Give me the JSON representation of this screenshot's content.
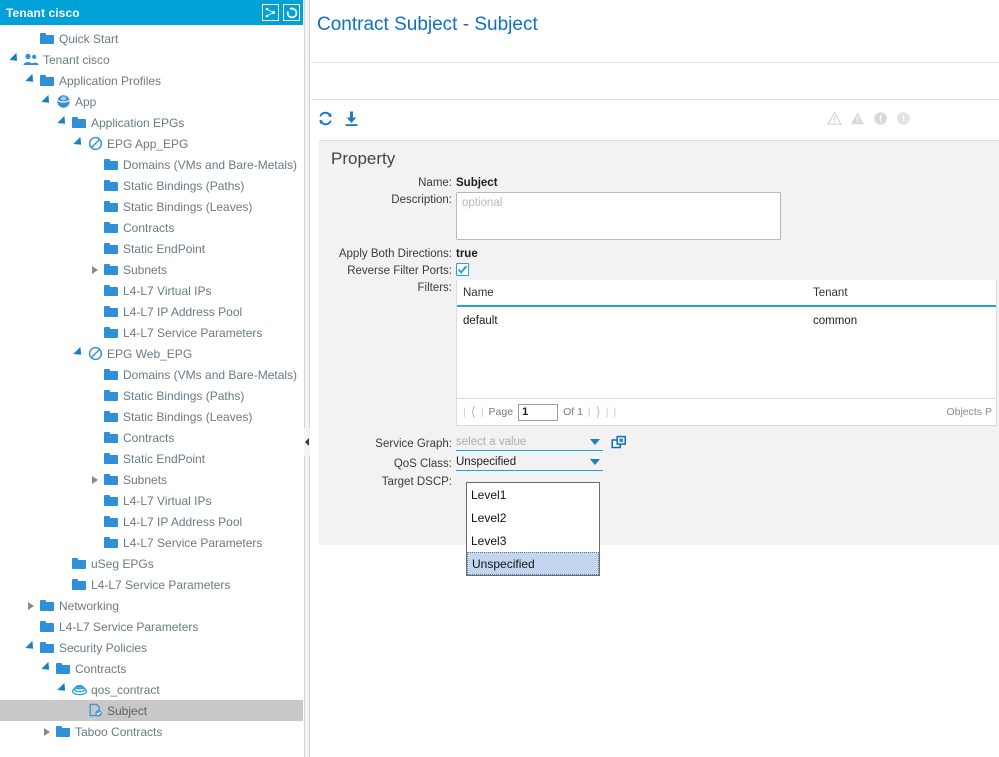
{
  "sidebar": {
    "title": "Tenant cisco",
    "title_icons": [
      {
        "name": "topology-icon"
      },
      {
        "name": "refresh-icon"
      }
    ],
    "tree": [
      {
        "label": "Quick Start",
        "indent": 1,
        "twisty": "none",
        "icon": "folder-icon"
      },
      {
        "label": "Tenant cisco",
        "indent": 0,
        "twisty": "open",
        "icon": "tenant-users-icon"
      },
      {
        "label": "Application Profiles",
        "indent": 1,
        "twisty": "open",
        "icon": "folder-icon"
      },
      {
        "label": "App",
        "indent": 2,
        "twisty": "open",
        "icon": "app-sphere-icon"
      },
      {
        "label": "Application EPGs",
        "indent": 3,
        "twisty": "open",
        "icon": "folder-icon"
      },
      {
        "label": "EPG App_EPG",
        "indent": 4,
        "twisty": "open",
        "icon": "epg-prohibit-icon"
      },
      {
        "label": "Domains (VMs and Bare-Metals)",
        "indent": 5,
        "twisty": "none",
        "icon": "folder-icon"
      },
      {
        "label": "Static Bindings (Paths)",
        "indent": 5,
        "twisty": "none",
        "icon": "folder-icon"
      },
      {
        "label": "Static Bindings (Leaves)",
        "indent": 5,
        "twisty": "none",
        "icon": "folder-icon"
      },
      {
        "label": "Contracts",
        "indent": 5,
        "twisty": "none",
        "icon": "folder-icon"
      },
      {
        "label": "Static EndPoint",
        "indent": 5,
        "twisty": "none",
        "icon": "folder-icon"
      },
      {
        "label": "Subnets",
        "indent": 5,
        "twisty": "closed",
        "icon": "folder-icon"
      },
      {
        "label": "L4-L7 Virtual IPs",
        "indent": 5,
        "twisty": "none",
        "icon": "folder-icon"
      },
      {
        "label": "L4-L7 IP Address Pool",
        "indent": 5,
        "twisty": "none",
        "icon": "folder-icon"
      },
      {
        "label": "L4-L7 Service Parameters",
        "indent": 5,
        "twisty": "none",
        "icon": "folder-icon"
      },
      {
        "label": "EPG Web_EPG",
        "indent": 4,
        "twisty": "open",
        "icon": "epg-prohibit-icon"
      },
      {
        "label": "Domains (VMs and Bare-Metals)",
        "indent": 5,
        "twisty": "none",
        "icon": "folder-icon"
      },
      {
        "label": "Static Bindings (Paths)",
        "indent": 5,
        "twisty": "none",
        "icon": "folder-icon"
      },
      {
        "label": "Static Bindings (Leaves)",
        "indent": 5,
        "twisty": "none",
        "icon": "folder-icon"
      },
      {
        "label": "Contracts",
        "indent": 5,
        "twisty": "none",
        "icon": "folder-icon"
      },
      {
        "label": "Static EndPoint",
        "indent": 5,
        "twisty": "none",
        "icon": "folder-icon"
      },
      {
        "label": "Subnets",
        "indent": 5,
        "twisty": "closed",
        "icon": "folder-icon"
      },
      {
        "label": "L4-L7 Virtual IPs",
        "indent": 5,
        "twisty": "none",
        "icon": "folder-icon"
      },
      {
        "label": "L4-L7 IP Address Pool",
        "indent": 5,
        "twisty": "none",
        "icon": "folder-icon"
      },
      {
        "label": "L4-L7 Service Parameters",
        "indent": 5,
        "twisty": "none",
        "icon": "folder-icon"
      },
      {
        "label": "uSeg EPGs",
        "indent": 3,
        "twisty": "none",
        "icon": "folder-icon"
      },
      {
        "label": "L4-L7 Service Parameters",
        "indent": 3,
        "twisty": "none",
        "icon": "folder-icon"
      },
      {
        "label": "Networking",
        "indent": 1,
        "twisty": "closed",
        "icon": "folder-icon"
      },
      {
        "label": "L4-L7 Service Parameters",
        "indent": 1,
        "twisty": "none",
        "icon": "folder-icon"
      },
      {
        "label": "Security Policies",
        "indent": 1,
        "twisty": "open",
        "icon": "folder-icon"
      },
      {
        "label": "Contracts",
        "indent": 2,
        "twisty": "open",
        "icon": "folder-icon"
      },
      {
        "label": "qos_contract",
        "indent": 3,
        "twisty": "open",
        "icon": "contract-icon"
      },
      {
        "label": "Subject",
        "indent": 4,
        "twisty": "none",
        "icon": "subject-icon",
        "selected": true
      },
      {
        "label": "Taboo Contracts",
        "indent": 2,
        "twisty": "closed",
        "icon": "folder-icon"
      }
    ]
  },
  "main": {
    "page_title": "Contract Subject - Subject",
    "toolbar": {
      "refresh_name": "refresh-icon",
      "download_name": "download-icon",
      "status_icons": [
        "warning-outline-icon",
        "warning-filled-icon",
        "error-filled-icon",
        "info-filled-icon"
      ]
    },
    "property": {
      "heading": "Property",
      "name_label": "Name:",
      "name_value": "Subject",
      "description_label": "Description:",
      "description_value": "",
      "description_placeholder": "optional",
      "apply_both_label": "Apply Both Directions:",
      "apply_both_value": "true",
      "reverse_filter_label": "Reverse Filter Ports:",
      "reverse_filter_checked": true,
      "filters_label": "Filters:",
      "service_graph_label": "Service Graph:",
      "service_graph_value": "select a value",
      "qos_class_label": "QoS Class:",
      "qos_class_value": "Unspecified",
      "target_dscp_label": "Target DSCP:"
    },
    "filters_table": {
      "columns": [
        "Name",
        "Tenant"
      ],
      "rows": [
        {
          "name": "default",
          "tenant": "common"
        }
      ],
      "pagination": {
        "page_label": "Page",
        "page_value": "1",
        "of_label": "Of 1",
        "objects_per_page_label": "Objects P"
      }
    },
    "qos_dropdown": {
      "open": true,
      "options": [
        "Level1",
        "Level2",
        "Level3",
        "Unspecified"
      ],
      "selected": "Unspecified"
    }
  },
  "colors": {
    "titlebar": "#00a0d8",
    "accent_blue": "#2f8fd8",
    "title_text": "#0f6fc6",
    "panel_bg": "#f2f2f2",
    "selection": "#c8c8c8",
    "dropdown_highlight": "#c3d5ef",
    "table_underline": "#1ea7d0"
  }
}
